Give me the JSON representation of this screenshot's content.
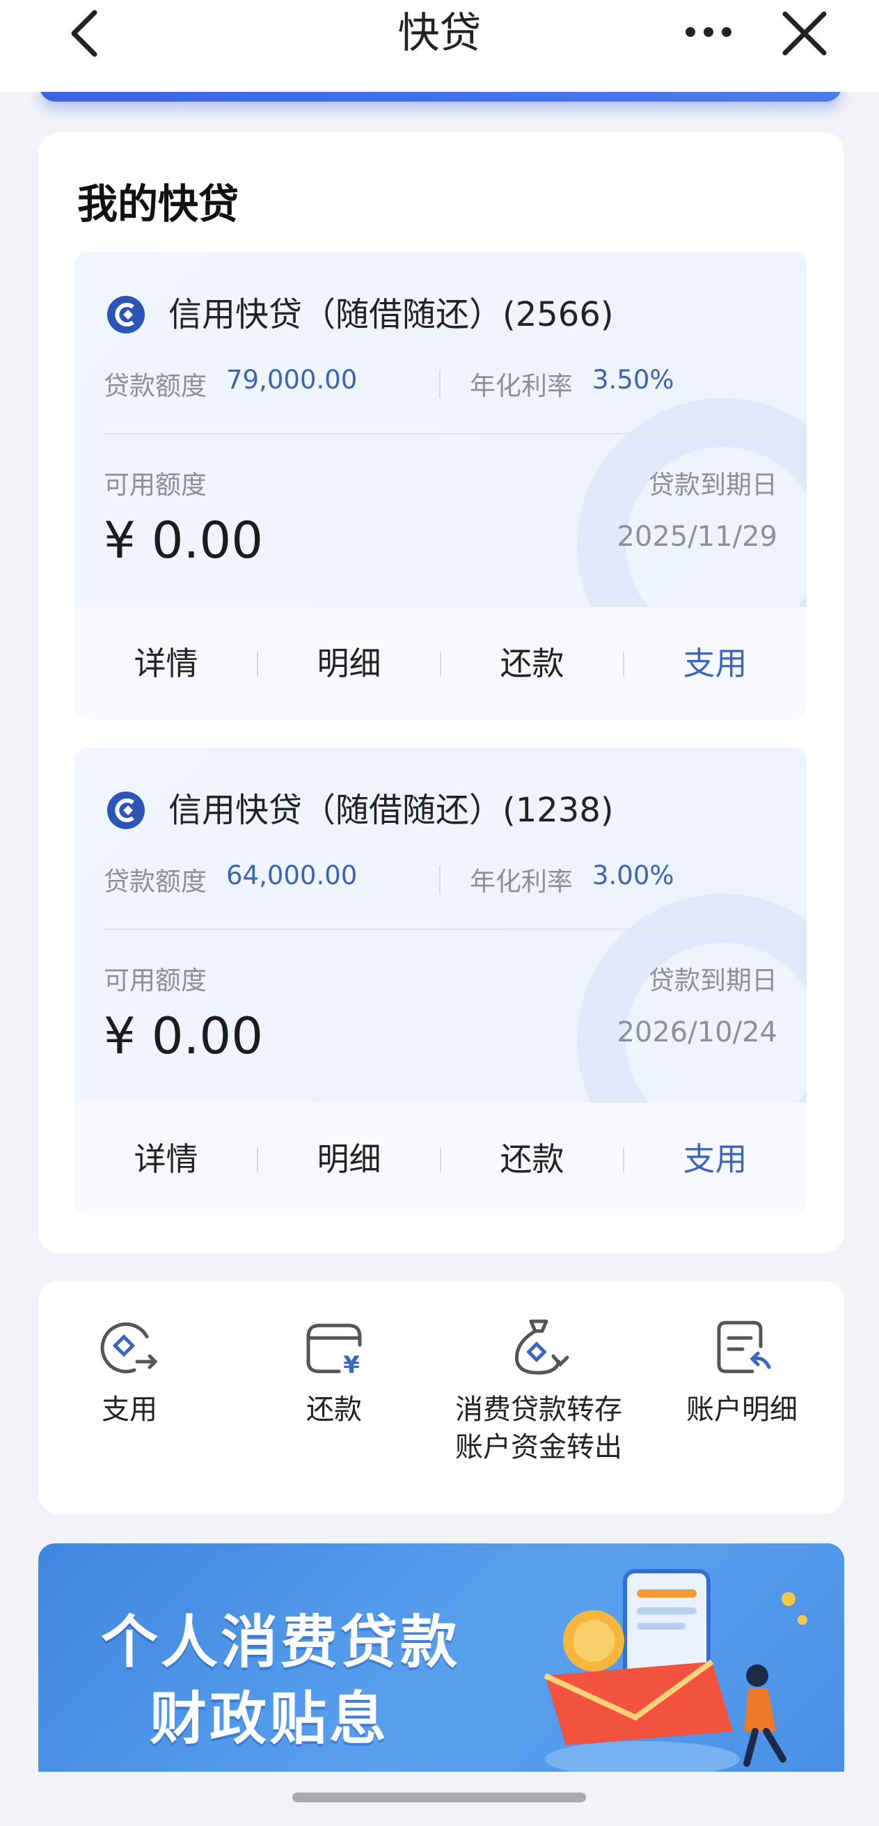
{
  "nav": {
    "title": "快贷"
  },
  "section_title": "我的快贷",
  "loans": [
    {
      "name": "信用快贷（随借随还）(2566)",
      "amount_label": "贷款额度",
      "amount": "79,000.00",
      "rate_label": "年化利率",
      "rate": "3.50%",
      "available_label": "可用额度",
      "available": "¥ 0.00",
      "due_label": "贷款到期日",
      "due_date": "2025/11/29",
      "actions": [
        "详情",
        "明细",
        "还款",
        "支用"
      ]
    },
    {
      "name": "信用快贷（随借随还）(1238)",
      "amount_label": "贷款额度",
      "amount": "64,000.00",
      "rate_label": "年化利率",
      "rate": "3.00%",
      "available_label": "可用额度",
      "available": "¥ 0.00",
      "due_label": "贷款到期日",
      "due_date": "2026/10/24",
      "actions": [
        "详情",
        "明细",
        "还款",
        "支用"
      ]
    }
  ],
  "quick_actions": [
    {
      "label": "支用",
      "icon": "withdraw-icon"
    },
    {
      "label": "还款",
      "icon": "repay-wallet-icon"
    },
    {
      "label_line1": "消费贷款转存",
      "label_line2": "账户资金转出",
      "icon": "money-bag-transfer-icon"
    },
    {
      "label": "账户明细",
      "icon": "account-statement-icon"
    }
  ],
  "banner": {
    "line1": "个人消费贷款",
    "line2": "财政贴息"
  },
  "colors": {
    "accent": "#3b66c0",
    "brand_blue": "#3a63e6",
    "muted": "#8a8f99"
  }
}
